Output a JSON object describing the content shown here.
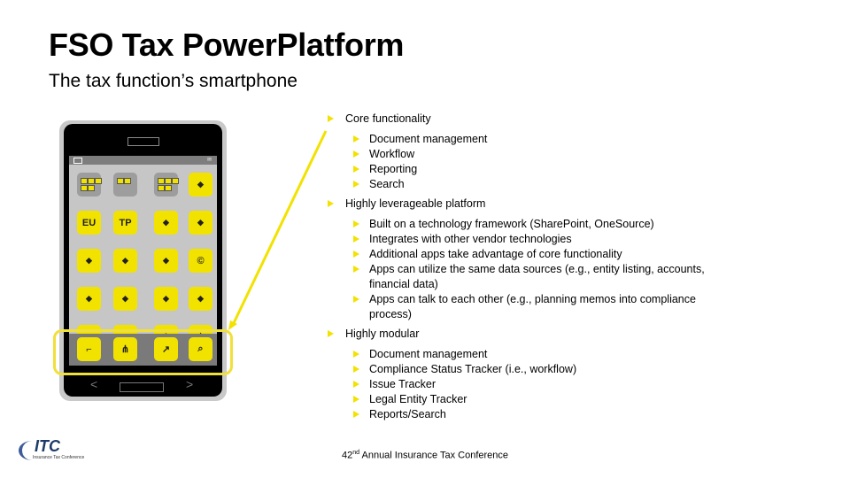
{
  "header": {
    "title": "FSO Tax PowerPlatform",
    "subtitle": "The tax function’s smartphone"
  },
  "phone": {
    "home_screen_apps": [
      {
        "icon": "folder-icon",
        "type": "folder"
      },
      {
        "icon": "folder-icon",
        "type": "folder"
      },
      {
        "icon": "folder-icon",
        "type": "folder"
      },
      {
        "icon": "checklist-icon",
        "type": "app"
      },
      {
        "icon": "shield-icon",
        "type": "app",
        "text": "EU"
      },
      {
        "icon": "tp-icon",
        "type": "app",
        "text": "TP"
      },
      {
        "icon": "map-icon",
        "type": "app"
      },
      {
        "icon": "org-chart-icon",
        "type": "app"
      },
      {
        "icon": "globe-icon",
        "type": "app"
      },
      {
        "icon": "hand-icon",
        "type": "app"
      },
      {
        "icon": "scales-icon",
        "type": "app"
      },
      {
        "icon": "copyright-icon",
        "type": "app",
        "text": "©"
      },
      {
        "icon": "team-icon",
        "type": "app"
      },
      {
        "icon": "network-icon",
        "type": "app"
      },
      {
        "icon": "presentation-icon",
        "type": "app"
      },
      {
        "icon": "wrench-icon",
        "type": "app"
      },
      {
        "icon": "head-icon",
        "type": "app"
      },
      {
        "icon": "calculator-icon",
        "type": "app"
      },
      {
        "icon": "warning-diamond-icon",
        "type": "app",
        "text": "!"
      },
      {
        "icon": "warning-triangle-icon",
        "type": "app",
        "text": "⚠"
      }
    ],
    "dock_apps": [
      {
        "icon": "document-icon"
      },
      {
        "icon": "workflow-icon"
      },
      {
        "icon": "reporting-icon"
      },
      {
        "icon": "search-icon"
      }
    ]
  },
  "bullets": [
    {
      "label": "Core functionality",
      "items": [
        "Document management",
        "Workflow",
        "Reporting",
        "Search"
      ]
    },
    {
      "label": "Highly leverageable platform",
      "items": [
        "Built on a technology framework (SharePoint, OneSource)",
        "Integrates with other vendor technologies",
        "Additional apps take advantage of core functionality",
        "Apps can utilize the same data sources (e.g., entity listing, accounts, financial data)",
        "Apps can talk to each other (e.g., planning memos into compliance process)"
      ]
    },
    {
      "label": "Highly modular",
      "items": [
        "Document management",
        "Compliance Status Tracker (i.e., workflow)",
        "Issue Tracker",
        "Legal Entity Tracker",
        "Reports/Search"
      ]
    }
  ],
  "footer": {
    "ordinal": "42",
    "ordinal_suffix": "nd",
    "conference": " Annual Insurance Tax Conference"
  },
  "logo": {
    "name": "ITC",
    "tagline": "Insurance Tax Conference"
  },
  "colors": {
    "accent": "#f2e200",
    "highlight": "#f0e03a"
  }
}
